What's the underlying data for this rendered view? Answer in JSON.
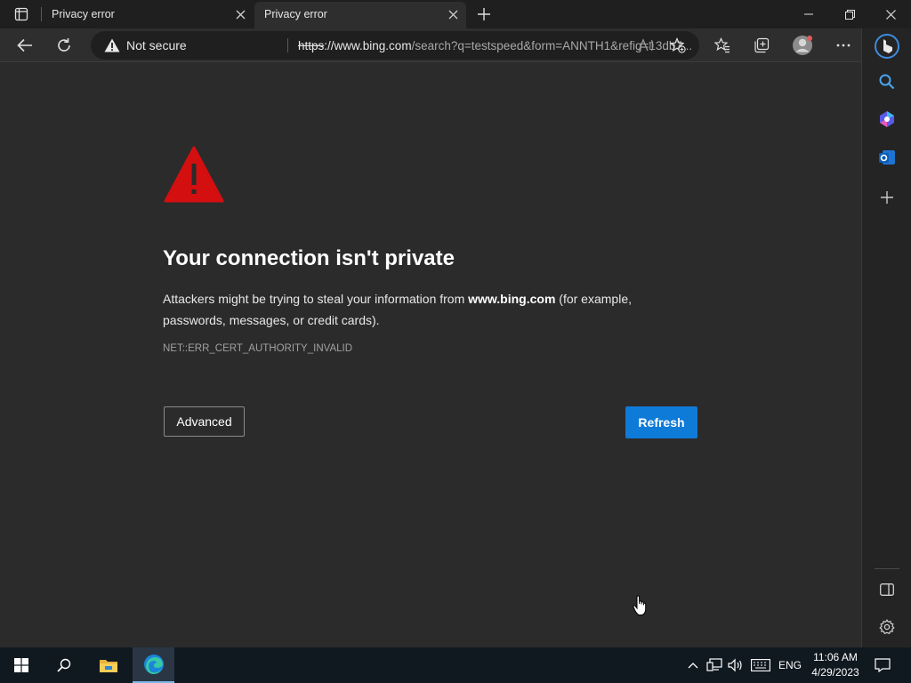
{
  "browser": {
    "tabs": [
      {
        "title": "Privacy error"
      },
      {
        "title": "Privacy error"
      }
    ],
    "address": {
      "security_label": "Not secure",
      "url_scheme": "https",
      "url_host": "://www.bing.com",
      "url_rest": "/search?q=testspeed&form=ANNTH1&refig=13db7..."
    }
  },
  "page": {
    "heading": "Your connection isn't private",
    "desc_before": "Attackers might be trying to steal your information from ",
    "desc_domain": "www.bing.com",
    "desc_after": " (for example, passwords, messages, or credit cards).",
    "error_code": "NET::ERR_CERT_AUTHORITY_INVALID",
    "advanced_label": "Advanced",
    "refresh_label": "Refresh"
  },
  "taskbar": {
    "language": "ENG",
    "time": "11:06 AM",
    "date": "4/29/2023"
  },
  "colors": {
    "accent": "#0f7bd8",
    "warning_red": "#d40f0f",
    "background": "#2b2b2b"
  }
}
